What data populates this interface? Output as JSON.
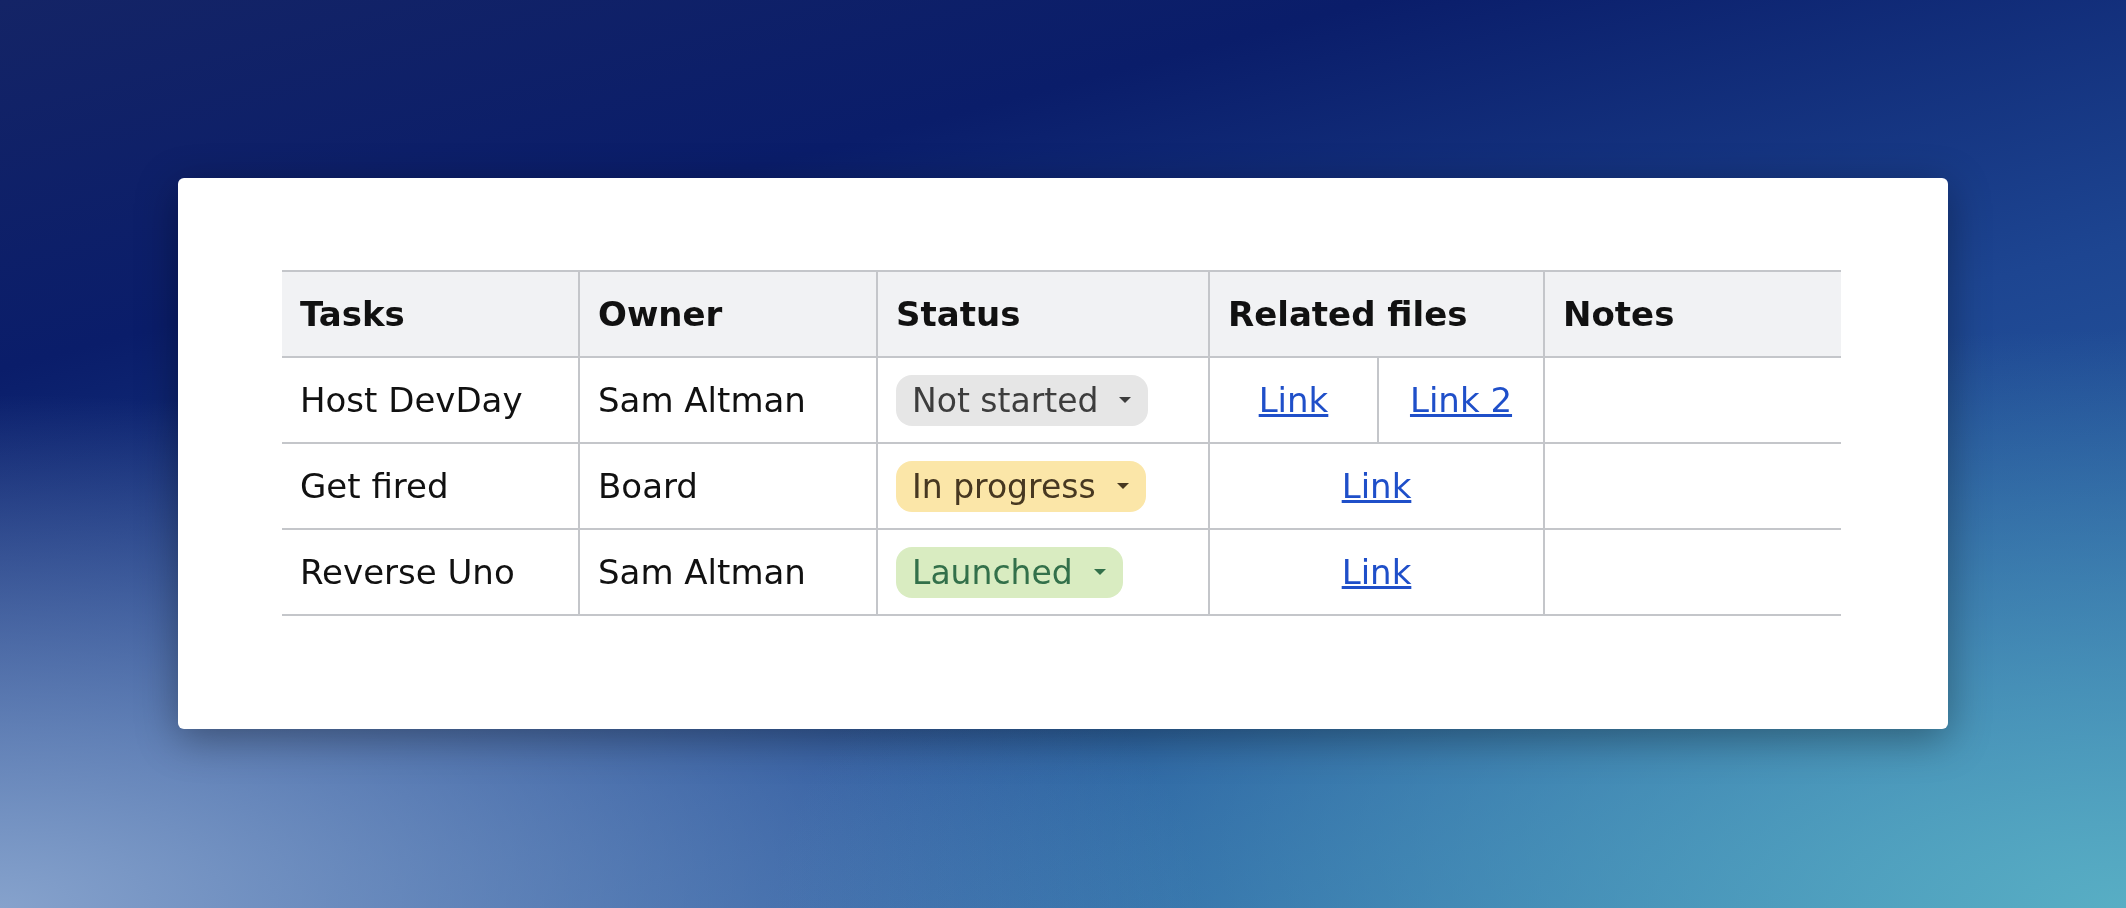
{
  "table": {
    "columns": [
      "Tasks",
      "Owner",
      "Status",
      "Related files",
      "Notes"
    ],
    "rows": [
      {
        "task": "Host DevDay",
        "owner": "Sam Altman",
        "status": {
          "label": "Not started",
          "kind": "neutral",
          "color": "#e6e6e6"
        },
        "links": [
          "Link",
          "Link 2"
        ]
      },
      {
        "task": "Get fired",
        "owner": "Board",
        "status": {
          "label": "In progress",
          "kind": "warning",
          "color": "#fbe6a8"
        },
        "links": [
          "Link"
        ]
      },
      {
        "task": "Reverse Uno",
        "owner": "Sam Altman",
        "status": {
          "label": "Launched",
          "kind": "success",
          "color": "#d9ecc1"
        },
        "links": [
          "Link"
        ]
      }
    ]
  }
}
